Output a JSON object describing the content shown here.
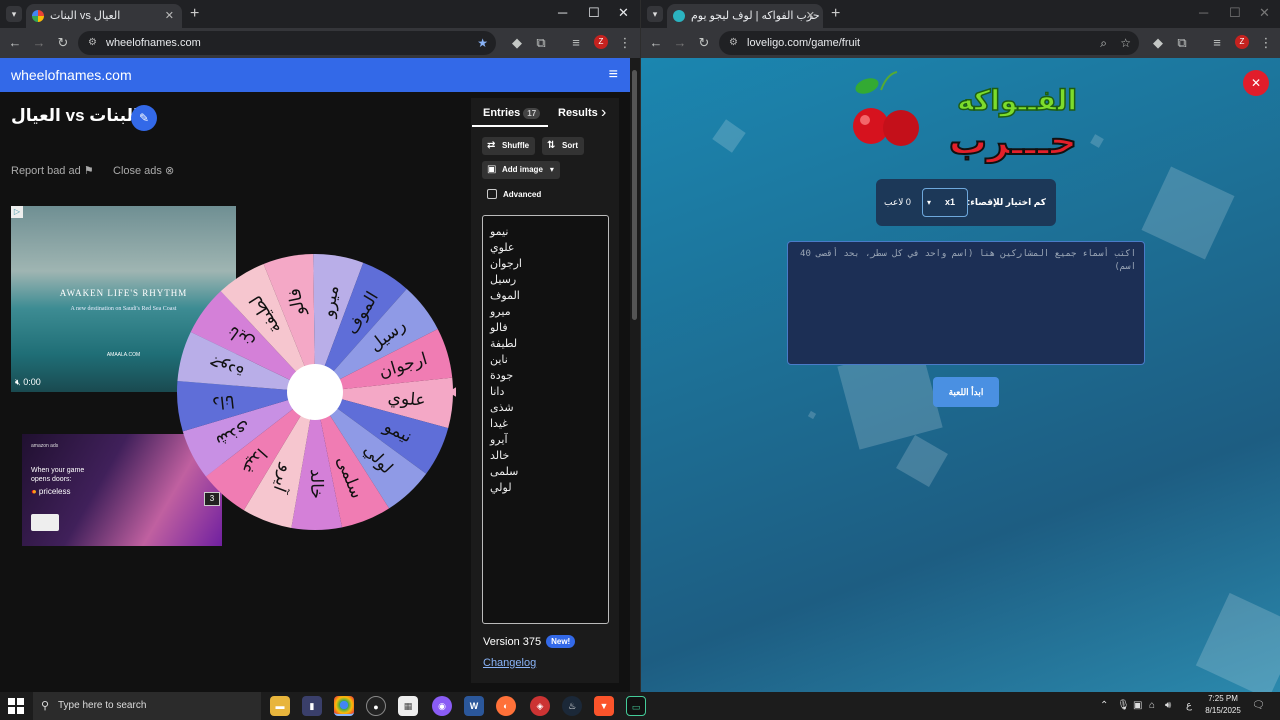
{
  "left_browser": {
    "tab_title": "البنات vs العيال",
    "url": "wheelofnames.com",
    "profile_letter": "Z"
  },
  "right_browser": {
    "tab_title": "لعبة حرب الفواكه | لوف ليجو يوم",
    "url": "loveligo.com/game/fruit",
    "profile_letter": "Z"
  },
  "wheel_page": {
    "header_title": "wheelofnames.com",
    "page_title": "البنات vs العيال",
    "report_ad": "Report bad ad",
    "close_ads": "Close ads",
    "ad_video": {
      "headline": "AWAKEN LIFE'S RHYTHM",
      "sub": "A new destination on Saudi's Red Sea Coast",
      "brand": "AMAALA.COM",
      "time": "0:00"
    },
    "ad_image": {
      "brand": "amazon ads",
      "copy": "When your game opens doors:",
      "mastercard": "priceless",
      "count": "3"
    },
    "entries_tab": "Entries",
    "entries_count": "17",
    "results_tab": "Results",
    "shuffle": "Shuffle",
    "sort": "Sort",
    "add_image": "Add image",
    "advanced": "Advanced",
    "entries": [
      "نيمو",
      "علوي",
      "ارجوان",
      "رسيل",
      "الموف",
      "ميرو",
      "فالو",
      "لطيفة",
      "ناين",
      "جودة",
      "دانا",
      "شذى",
      "غيدا",
      "آيرو",
      "خالد",
      "سلمى",
      "لولي"
    ],
    "wheel_labels": [
      "علوي",
      "نيمو",
      "لولي",
      "سلمى",
      "خالد",
      "آيرو",
      "غيدا",
      "شذى",
      "دانا",
      "جودة",
      "ناين",
      "لطيفة",
      "فالو",
      "ميرو",
      "الموف",
      "رسيل",
      "ارجوان"
    ],
    "wheel_colors": [
      "#f4a8c6",
      "#5f6ed8",
      "#8f9ae6",
      "#f07cb3",
      "#d480d8",
      "#f6c6cf",
      "#f07cb3",
      "#c890e4",
      "#5f6ed8",
      "#b9aee8",
      "#d480d8",
      "#f6c6cf",
      "#f4a8c6",
      "#b9aee8",
      "#5f6ed8",
      "#8f9ae6",
      "#f07cb3"
    ],
    "version": "Version 375",
    "new_badge": "New!",
    "changelog": "Changelog"
  },
  "game_page": {
    "logo_top": "الفــواكه",
    "logo_bottom": "حـــرب",
    "elimination_label": "كم اختيار للإقصاء:",
    "elimination_value": "x1",
    "players": "0 لاعب",
    "textarea_placeholder": "اكتب أسماء جميع المشاركين هنا (اسم واحد في كل سطر، بحد أقصى 40 اسم)",
    "start_button": "ابدأ اللعبة"
  },
  "taskbar": {
    "search_placeholder": "Type here to search",
    "time": "7:25 PM",
    "date": "8/15/2025",
    "lang": "ع"
  }
}
